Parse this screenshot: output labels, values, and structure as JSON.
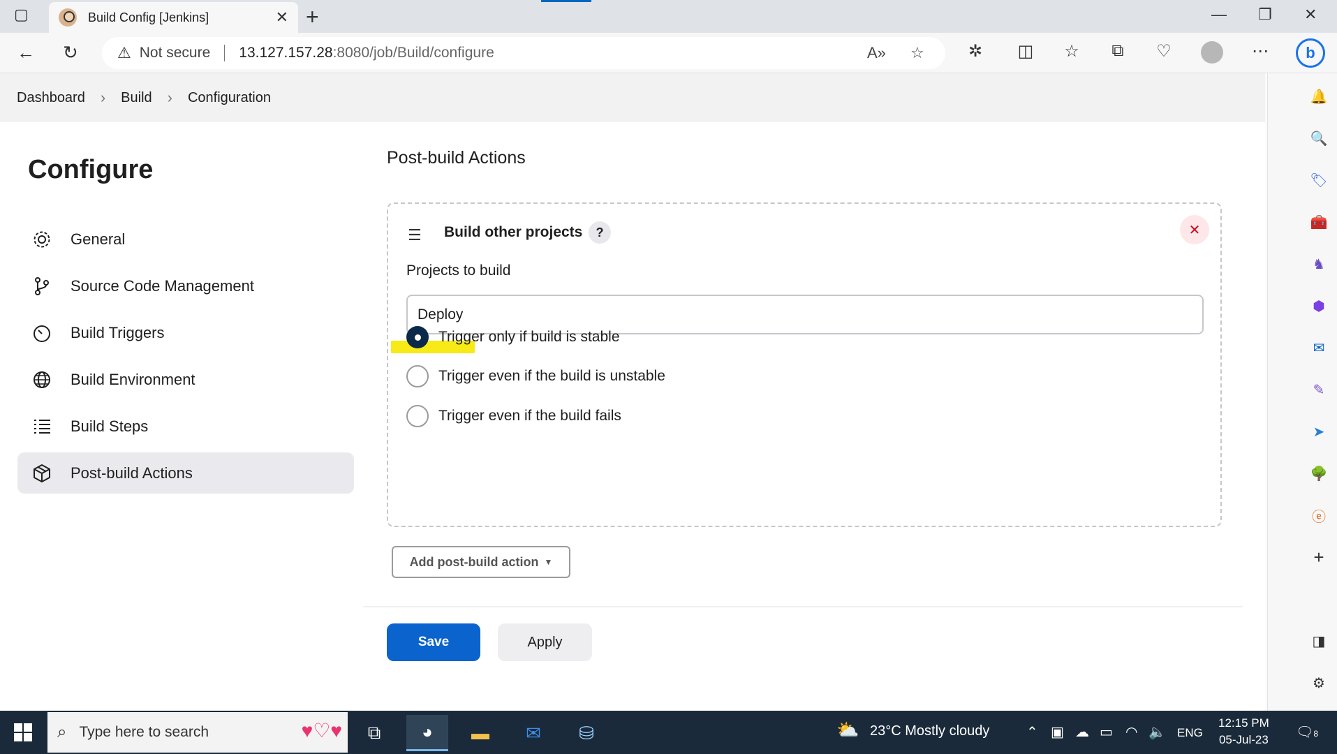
{
  "browser": {
    "tab_title": "Build Config [Jenkins]",
    "security_label": "Not secure",
    "url_host": "13.127.157.28",
    "url_path": ":8080/job/Build/configure"
  },
  "breadcrumb": [
    "Dashboard",
    "Build",
    "Configuration"
  ],
  "sidebar": {
    "title": "Configure",
    "items": [
      {
        "label": "General",
        "icon": "gear-icon"
      },
      {
        "label": "Source Code Management",
        "icon": "branch-icon"
      },
      {
        "label": "Build Triggers",
        "icon": "timer-icon"
      },
      {
        "label": "Build Environment",
        "icon": "globe-icon"
      },
      {
        "label": "Build Steps",
        "icon": "list-icon"
      },
      {
        "label": "Post-build Actions",
        "icon": "package-icon",
        "active": true
      }
    ]
  },
  "main": {
    "section_title": "Post-build Actions",
    "panel": {
      "title": "Build other projects",
      "help": "?",
      "field_label": "Projects to build",
      "field_value": "Deploy",
      "radios": [
        {
          "label": "Trigger only if build is stable",
          "checked": true
        },
        {
          "label": "Trigger even if the build is unstable",
          "checked": false
        },
        {
          "label": "Trigger even if the build fails",
          "checked": false
        }
      ]
    },
    "add_button": "Add post-build action",
    "save_button": "Save",
    "apply_button": "Apply"
  },
  "taskbar": {
    "search_placeholder": "Type here to search",
    "weather": "23°C  Mostly cloudy",
    "language": "ENG",
    "time": "12:15 PM",
    "date": "05-Jul-23",
    "notifications": "8"
  },
  "colors": {
    "primary": "#0b63ce",
    "radio_checked": "#0b2a4a",
    "highlight": "#f7ea16",
    "close_red": "#d0021b"
  }
}
